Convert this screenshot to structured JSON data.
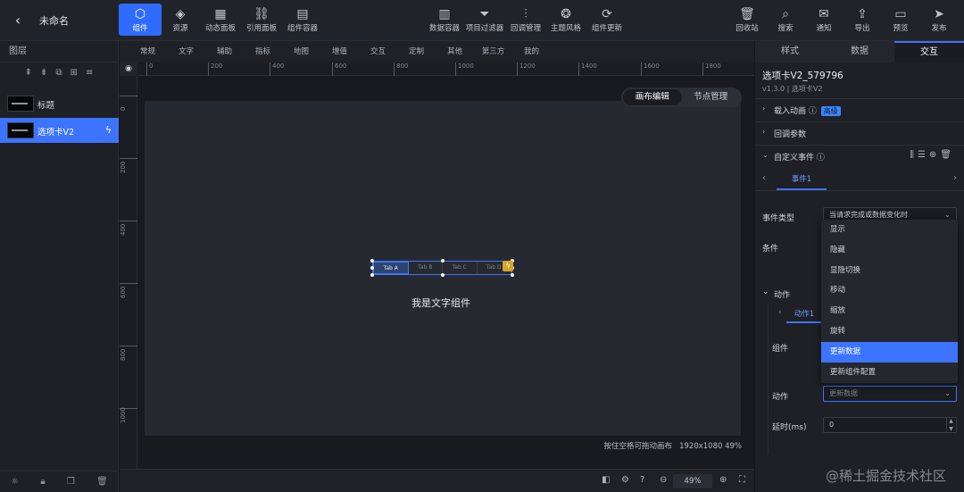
{
  "topbar": {
    "project_name": "未命名",
    "left_buttons": [
      {
        "icon": "component-icon",
        "glyph": "⬡",
        "label": "组件",
        "active": true
      },
      {
        "icon": "layers-icon",
        "glyph": "◈",
        "label": "资源"
      },
      {
        "icon": "panel-icon",
        "glyph": "▦",
        "label": "动态面板"
      },
      {
        "icon": "link-icon",
        "glyph": "⛓",
        "label": "引用面板"
      },
      {
        "icon": "container-icon",
        "glyph": "▤",
        "label": "组件容器"
      }
    ],
    "middle_buttons": [
      {
        "icon": "data-container-icon",
        "glyph": "▥",
        "label": "数据容器"
      },
      {
        "icon": "filter-icon",
        "glyph": "⏷",
        "label": "项目过滤器"
      },
      {
        "icon": "callback-icon",
        "glyph": "⫶",
        "label": "回调管理"
      },
      {
        "icon": "theme-icon",
        "glyph": "❂",
        "label": "主题风格"
      },
      {
        "icon": "refresh-icon",
        "glyph": "⟳",
        "label": "组件更新"
      }
    ],
    "right_buttons": [
      {
        "icon": "trash-icon",
        "glyph": "🗑",
        "label": "回收站"
      },
      {
        "icon": "search-icon",
        "glyph": "⌕",
        "label": "搜索"
      },
      {
        "icon": "message-icon",
        "glyph": "✉",
        "label": "通知"
      },
      {
        "icon": "export-icon",
        "glyph": "⇪",
        "label": "导出"
      },
      {
        "icon": "preview-icon",
        "glyph": "▭",
        "label": "预览"
      },
      {
        "icon": "publish-icon",
        "glyph": "➤",
        "label": "发布"
      }
    ]
  },
  "left_panel": {
    "title": "图层",
    "layers": [
      {
        "name": "标题",
        "selected": false
      },
      {
        "name": "选项卡V2",
        "selected": true
      }
    ]
  },
  "center": {
    "categories": [
      "常规",
      "文字",
      "辅助",
      "指标",
      "地图",
      "增值",
      "交互",
      "定制",
      "其他",
      "第三方",
      "我的"
    ],
    "ruler_h": [
      "0",
      "200",
      "400",
      "600",
      "800",
      "1000",
      "1200",
      "1400",
      "1600",
      "1800"
    ],
    "ruler_v": [
      "0",
      "200",
      "400",
      "600",
      "800",
      "1000"
    ],
    "mode_toggle": {
      "canvas_edit": "画布编辑",
      "node_manage": "节点管理"
    },
    "tab_component": {
      "tabs": [
        "Tab A",
        "Tab B",
        "Tab C",
        "Tab D"
      ],
      "active": 0
    },
    "text_component": "我是文字组件",
    "canvas_hint": "按住空格可拖动画布",
    "canvas_size": "1920x1080 49%",
    "zoom": "49%"
  },
  "right_panel": {
    "tabs": [
      "样式",
      "数据",
      "交互"
    ],
    "active_tab": 2,
    "component_title": "选项卡V2_579796",
    "component_version": "v1.3.0 | 选项卡V2",
    "load_animation": "载入动画",
    "load_animation_badge": "高级",
    "callback_params": "回调参数",
    "custom_events": "自定义事件",
    "event_tab": "事件1",
    "event_type_label": "事件类型",
    "event_type_value": "当请求完成或数据变化时",
    "condition_label": "条件",
    "action_section": "动作",
    "action_tab": "动作1",
    "component_label": "组件",
    "action_label": "动作",
    "action_value": "更新数据",
    "delay_label": "延时(ms)",
    "delay_value": "0",
    "dropdown_options": [
      "显示",
      "隐藏",
      "显隐切换",
      "移动",
      "缩放",
      "旋转",
      "更新数据",
      "更新组件配置"
    ],
    "dropdown_selected": 6
  },
  "watermark": "@稀土掘金技术社区"
}
